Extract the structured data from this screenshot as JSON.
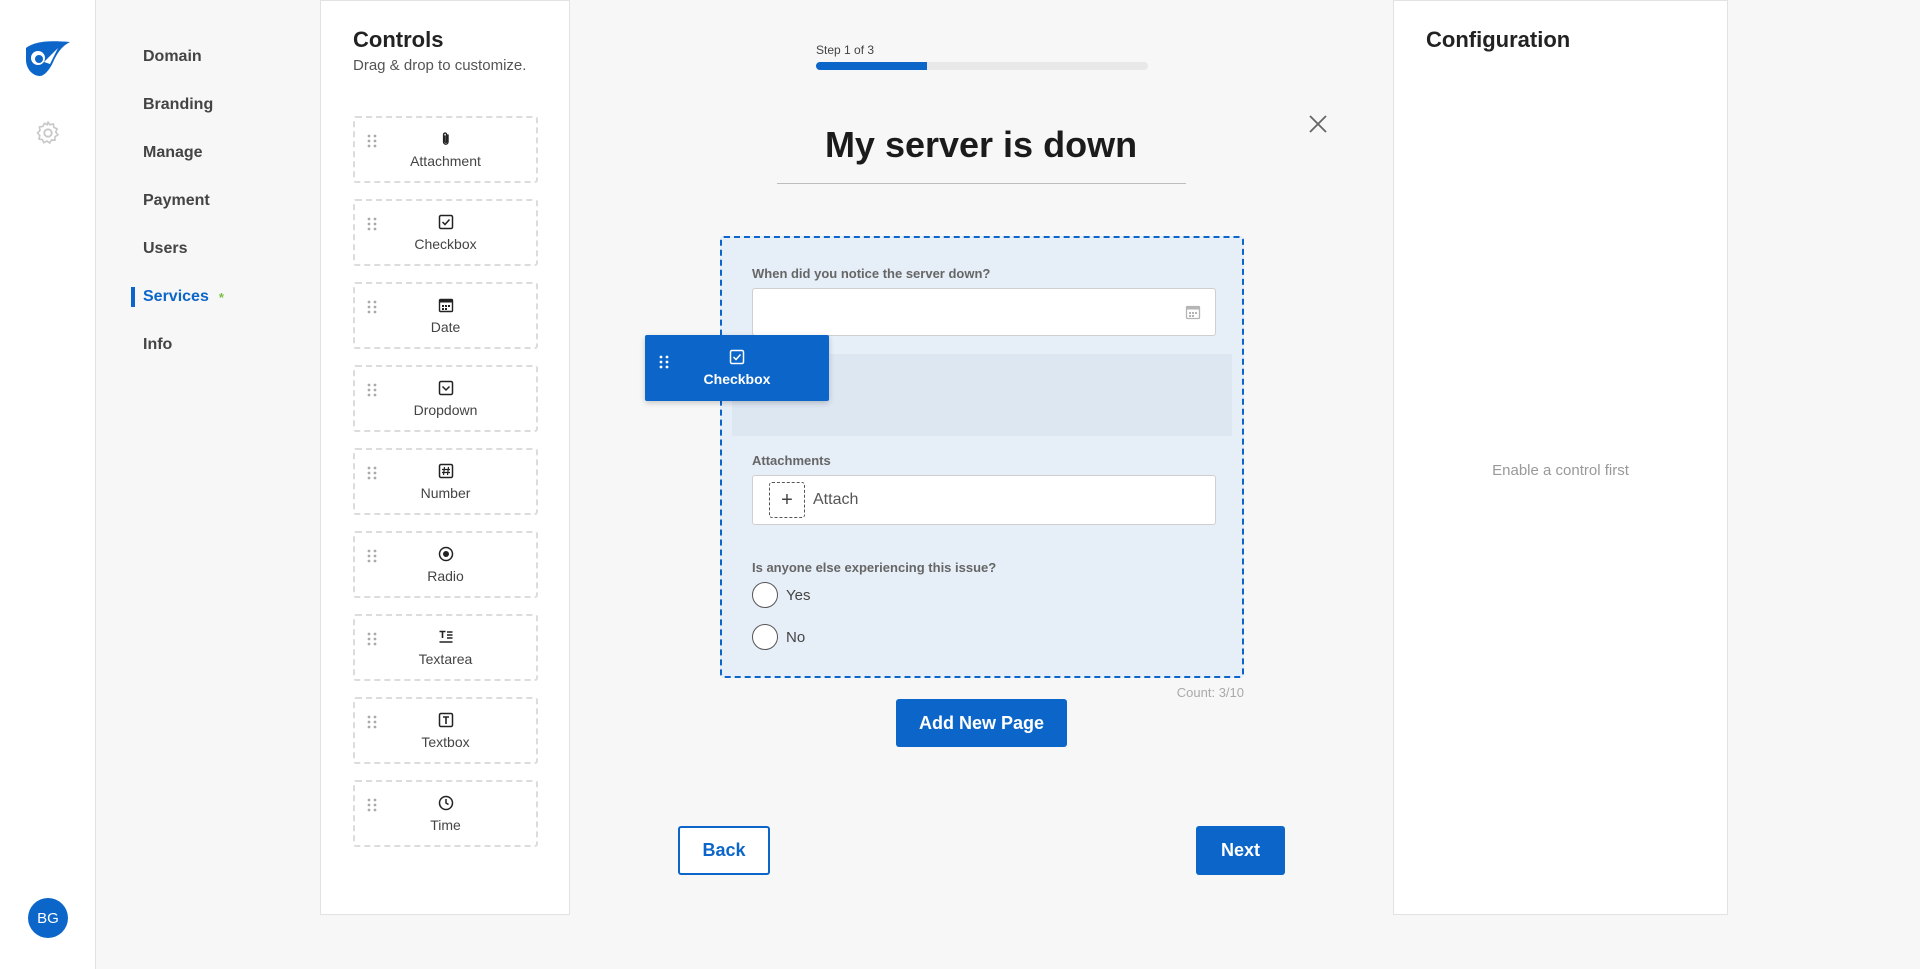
{
  "app": {
    "avatar_initials": "BG",
    "accent_color": "#0c66c9"
  },
  "nav": {
    "items": [
      {
        "label": "Domain"
      },
      {
        "label": "Branding"
      },
      {
        "label": "Manage"
      },
      {
        "label": "Payment"
      },
      {
        "label": "Users"
      },
      {
        "label": "Services",
        "active": true,
        "badge": "*"
      },
      {
        "label": "Info"
      }
    ]
  },
  "controls": {
    "title": "Controls",
    "subtitle": "Drag & drop to customize.",
    "items": [
      {
        "label": "Attachment",
        "icon": "paperclip-icon"
      },
      {
        "label": "Checkbox",
        "icon": "checkbox-icon"
      },
      {
        "label": "Date",
        "icon": "calendar-icon"
      },
      {
        "label": "Dropdown",
        "icon": "dropdown-icon"
      },
      {
        "label": "Number",
        "icon": "number-icon"
      },
      {
        "label": "Radio",
        "icon": "radio-icon"
      },
      {
        "label": "Textarea",
        "icon": "textarea-icon"
      },
      {
        "label": "Textbox",
        "icon": "textbox-icon"
      },
      {
        "label": "Time",
        "icon": "clock-icon"
      }
    ]
  },
  "form": {
    "step_text": "Step 1 of 3",
    "progress_fraction": 0.333,
    "title": "My server is down",
    "date_label": "When did you notice the server down?",
    "attachments_label": "Attachments",
    "attach_text": "Attach",
    "radio_label": "Is anyone else experiencing this issue?",
    "radio_options": [
      "Yes",
      "No"
    ],
    "count_text": "Count: 3/10",
    "add_page_label": "Add New Page",
    "back_label": "Back",
    "next_label": "Next",
    "dragging_label": "Checkbox"
  },
  "config": {
    "title": "Configuration",
    "empty_text": "Enable a control first"
  }
}
